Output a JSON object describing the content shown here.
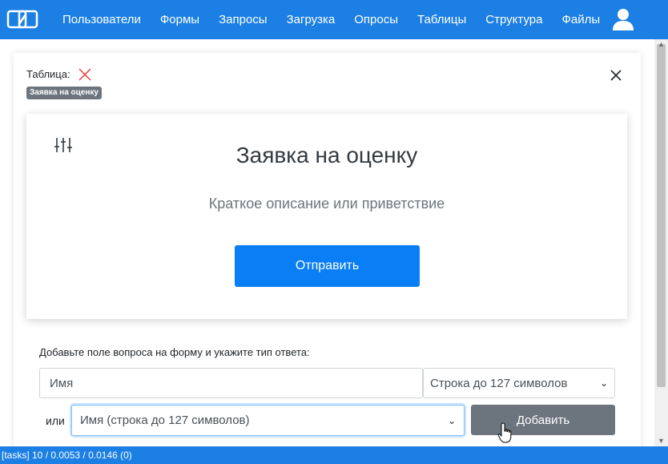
{
  "navbar": {
    "logo": "brand-logo-icon",
    "items": [
      {
        "label": "Пользователи"
      },
      {
        "label": "Формы"
      },
      {
        "label": "Запросы"
      },
      {
        "label": "Загрузка"
      },
      {
        "label": "Опросы"
      },
      {
        "label": "Таблицы"
      },
      {
        "label": "Структура"
      },
      {
        "label": "Файлы"
      }
    ],
    "user_icon": "user-icon",
    "color": "#1b7fe3"
  },
  "modal": {
    "table_label": "Таблица:",
    "table_badge": "Заявка на оценку",
    "close_icon": "close-icon",
    "form_preview": {
      "title": "Заявка на оценку",
      "description": "Краткое описание или приветствие",
      "submit_label": "Отправить",
      "settings_icon": "sliders-icon"
    },
    "add_field": {
      "label": "Добавьте поле вопроса на форму и укажите тип ответа:",
      "name_value": "Имя",
      "type_selected": "Строка до 127 символов",
      "or_label": "или",
      "preset_selected": "Имя (строка до 127 символов)",
      "add_label": "Добавить"
    }
  },
  "statusbar": {
    "text": "[tasks] 10 / 0.0053 / 0.0146 (0)"
  },
  "colors": {
    "primary": "#0a7ff5",
    "secondary": "#6c757d",
    "danger": "#e53935"
  }
}
